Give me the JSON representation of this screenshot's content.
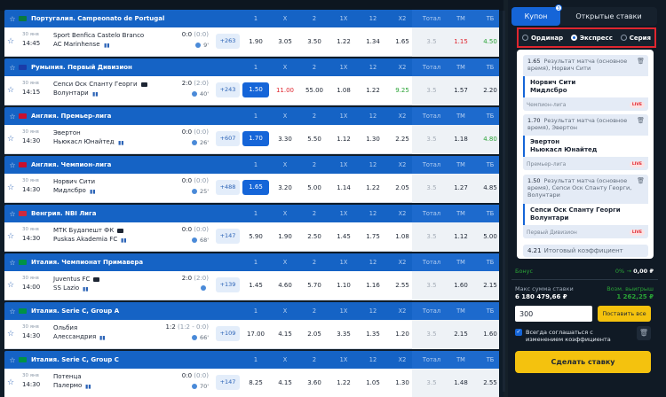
{
  "columns": [
    "1",
    "X",
    "2",
    "1X",
    "12",
    "X2",
    "Тотал",
    "ТМ",
    "ТБ"
  ],
  "matches": [
    {
      "league": "Португалия. Campeonato de Portugal",
      "flag": "#0a7a3e",
      "date": "30 янв",
      "time": "14:45",
      "team1": "Sport Benfica Castelo Branco",
      "team2": "AC Marinhense",
      "tv": false,
      "score": "0:0",
      "ht": "(0:0)",
      "minute": "9'",
      "more": "+263",
      "odds": [
        "1.90",
        "3.05",
        "3.50",
        "1.22",
        "1.34",
        "1.65",
        "3.5",
        "1.15",
        "4.50"
      ],
      "red": [
        7
      ],
      "green": [
        8
      ],
      "sel": []
    },
    {
      "league": "Румыния. Первый Дивизион",
      "flag": "#1a3ca8",
      "date": "30 янв",
      "time": "14:15",
      "team1": "Сепси Оск Спанту Георги",
      "team2": "Волунтари",
      "tv": true,
      "score": "2:0",
      "ht": "(2:0)",
      "minute": "40'",
      "more": "+243",
      "odds": [
        "1.50",
        "11.00",
        "55.00",
        "1.08",
        "1.22",
        "9.25",
        "3.5",
        "1.57",
        "2.20"
      ],
      "red": [
        1
      ],
      "green": [
        5
      ],
      "sel": [
        0
      ]
    },
    {
      "league": "Англия. Премьер-лига",
      "flag": "#c8102e",
      "date": "30 янв",
      "time": "14:30",
      "team1": "Эвертон",
      "team2": "Ньюкасл Юнайтед",
      "tv": false,
      "score": "0:0",
      "ht": "(0:0)",
      "minute": "26'",
      "more": "+607",
      "odds": [
        "1.70",
        "3.30",
        "5.50",
        "1.12",
        "1.30",
        "2.25",
        "3.5",
        "1.18",
        "4.80"
      ],
      "red": [],
      "green": [
        8
      ],
      "sel": [
        0
      ]
    },
    {
      "league": "Англия. Чемпион-лига",
      "flag": "#c8102e",
      "date": "30 янв",
      "time": "14:30",
      "team1": "Норвич Сити",
      "team2": "Мидлсбро",
      "tv": false,
      "score": "0:0",
      "ht": "(0:0)",
      "minute": "25'",
      "more": "+488",
      "odds": [
        "1.65",
        "3.20",
        "5.00",
        "1.14",
        "1.22",
        "2.05",
        "3.5",
        "1.27",
        "4.85"
      ],
      "red": [],
      "green": [],
      "sel": [
        0
      ]
    },
    {
      "league": "Венгрия. NBI Лига",
      "flag": "#cd2a3e",
      "date": "30 янв",
      "time": "14:30",
      "team1": "МТК Будапешт ФК",
      "team2": "Puskas Akademia FC",
      "tv": true,
      "score": "0:0",
      "ht": "(0:0)",
      "minute": "68'",
      "more": "+147",
      "odds": [
        "5.90",
        "1.90",
        "2.50",
        "1.45",
        "1.75",
        "1.08",
        "3.5",
        "1.12",
        "5.00"
      ],
      "red": [],
      "green": [],
      "sel": []
    },
    {
      "league": "Италия. Чемпионат Примавера",
      "flag": "#009246",
      "date": "30 янв",
      "time": "14:00",
      "team1": "Juventus FC",
      "team2": "SS Lazio",
      "tv": true,
      "score": "2:0",
      "ht": "(2:0)",
      "minute": "",
      "more": "+139",
      "odds": [
        "1.45",
        "4.60",
        "5.70",
        "1.10",
        "1.16",
        "2.55",
        "3.5",
        "1.60",
        "2.15"
      ],
      "red": [],
      "green": [],
      "sel": []
    },
    {
      "league": "Италия. Serie C, Group A",
      "flag": "#009246",
      "date": "30 янв",
      "time": "14:30",
      "team1": "Ольбия",
      "team2": "Алессандрия",
      "tv": false,
      "score": "1:2",
      "ht": "(1:2 - 0:0)",
      "minute": "66'",
      "more": "+109",
      "odds": [
        "17.00",
        "4.15",
        "2.05",
        "3.35",
        "1.35",
        "1.20",
        "3.5",
        "2.15",
        "1.60"
      ],
      "red": [],
      "green": [],
      "sel": []
    },
    {
      "league": "Италия. Serie C, Group C",
      "flag": "#009246",
      "date": "30 янв",
      "time": "14:30",
      "team1": "Потенца",
      "team2": "Палермо",
      "tv": false,
      "score": "0:0",
      "ht": "(0:0)",
      "minute": "70'",
      "more": "+147",
      "odds": [
        "8.25",
        "4.15",
        "3.60",
        "1.22",
        "1.05",
        "1.30",
        "3.5",
        "1.48",
        "2.55"
      ],
      "red": [],
      "green": [],
      "sel": []
    }
  ],
  "coupon": {
    "tab_coupon": "Купон",
    "tab_count": "3",
    "tab_open": "Открытые ставки",
    "mode1": "Ординар",
    "mode2": "Экспресс",
    "mode3": "Серия",
    "bets": [
      {
        "coef": "1.65",
        "desc": "Результат матча (основное время), Норвич Сити",
        "t1": "Норвич Сити",
        "t2": "Мидлсбро",
        "league": "Чемпион-лига"
      },
      {
        "coef": "1.70",
        "desc": "Результат матча (основное время), Эвертон",
        "t1": "Эвертон",
        "t2": "Ньюкасл Юнайтед",
        "league": "Премьер-лига"
      },
      {
        "coef": "1.50",
        "desc": "Результат матча (основное время), Сепси Оск Спанту Георги, Волунтари",
        "t1": "Сепси Оск Спанту Георги",
        "t2": "Волунтари",
        "league": "Первый Дивизион"
      }
    ],
    "live": "LIVE",
    "total_coef": "4.21",
    "total_label": "Итоговый коэффициент",
    "bonus_label": "Бонус",
    "bonus_pct": "0%",
    "bonus_arrow": "→",
    "bonus_value": "0,00 ₽",
    "max_label": "Макс сумма ставки",
    "max_value": "6 180 479,66 ₽",
    "win_label": "Возм. выигрыш",
    "win_value": "1 262,25 ₽",
    "stake": "300",
    "stake_all": "Поставить все",
    "agree": "Всегда соглашаться с изменением коэффициента",
    "place": "Сделать ставку"
  }
}
